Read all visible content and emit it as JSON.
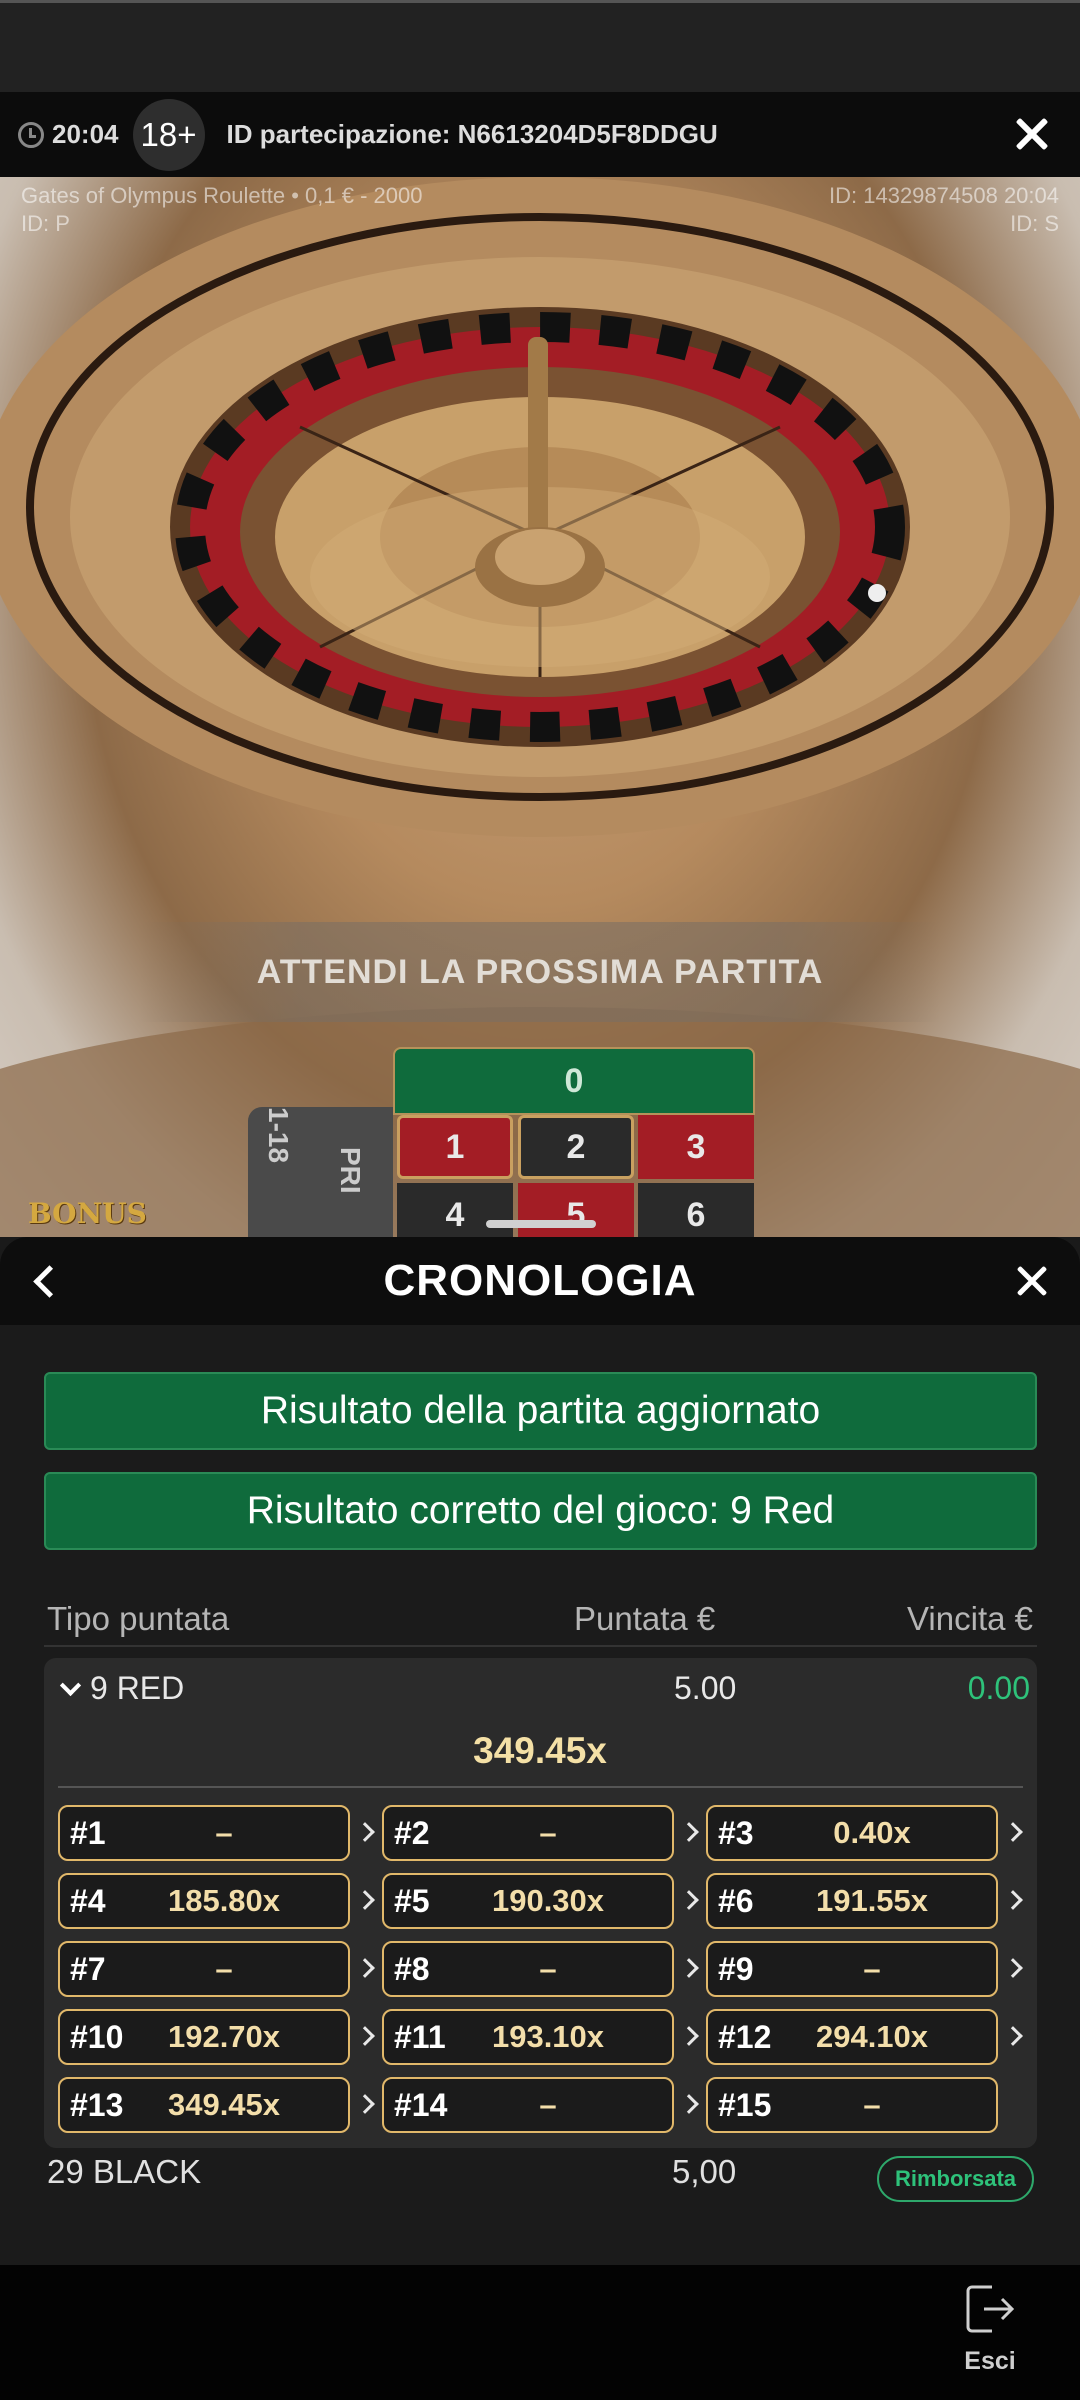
{
  "header": {
    "time": "20:04",
    "age_badge": "18+",
    "participation_id": "ID partecipazione: N6613204D5F8DDGU"
  },
  "video": {
    "table_info": "Gates of Olympus Roulette • 0,1 € - 2000",
    "left_id": "ID: P",
    "round_id": "ID: 14329874508 20:04",
    "right_id": "ID: S",
    "wait_text": "ATTENDI LA PROSSIMA PARTITA",
    "bonus_logo": "BONUS",
    "table": {
      "zero": "0",
      "row1": [
        "1",
        "2",
        "3"
      ],
      "row2": [
        "4",
        "5",
        "6"
      ],
      "side_label_1": "1-18",
      "side_label_2": "PRI"
    }
  },
  "sheet": {
    "title": "CRONOLOGIA",
    "notice_updated": "Risultato della partita aggiornato",
    "notice_correct": "Risultato corretto del gioco: 9 Red",
    "columns": {
      "type": "Tipo puntata",
      "stake": "Puntata €",
      "win": "Vincita €"
    },
    "bets": [
      {
        "type": "9 RED",
        "stake": "5.00",
        "win": "0.00",
        "total_multiplier": "349.45x",
        "rounds": [
          {
            "label": "#1",
            "value": "–"
          },
          {
            "label": "#2",
            "value": "–"
          },
          {
            "label": "#3",
            "value": "0.40x"
          },
          {
            "label": "#4",
            "value": "185.80x"
          },
          {
            "label": "#5",
            "value": "190.30x"
          },
          {
            "label": "#6",
            "value": "191.55x"
          },
          {
            "label": "#7",
            "value": "–"
          },
          {
            "label": "#8",
            "value": "–"
          },
          {
            "label": "#9",
            "value": "–"
          },
          {
            "label": "#10",
            "value": "192.70x"
          },
          {
            "label": "#11",
            "value": "193.10x"
          },
          {
            "label": "#12",
            "value": "294.10x"
          },
          {
            "label": "#13",
            "value": "349.45x"
          },
          {
            "label": "#14",
            "value": "–"
          },
          {
            "label": "#15",
            "value": "–"
          }
        ]
      },
      {
        "type": "29 BLACK",
        "stake": "5,00",
        "status": "Rimborsata"
      }
    ]
  },
  "footer": {
    "exit_label": "Esci"
  },
  "colors": {
    "accent_green": "#0f6b3c",
    "win_green": "#2ec27a",
    "gold": "#e1b86a",
    "roulette_red": "#a31d25"
  }
}
